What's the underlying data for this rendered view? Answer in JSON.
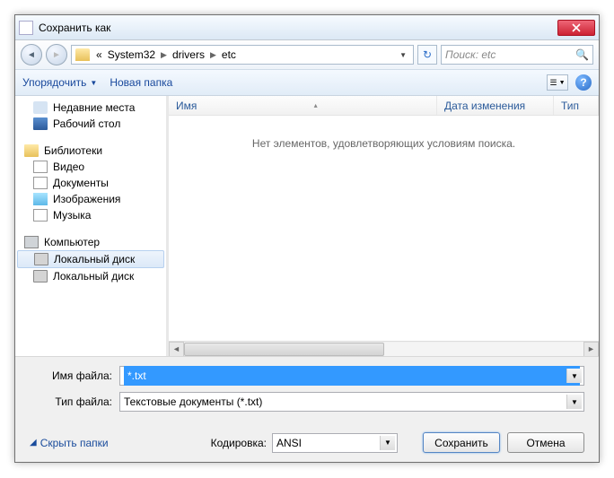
{
  "title": "Сохранить как",
  "breadcrumb": {
    "sep0": "«",
    "p1": "System32",
    "p2": "drivers",
    "p3": "etc"
  },
  "search": {
    "placeholder": "Поиск: etc"
  },
  "toolbar": {
    "organize": "Упорядочить",
    "newfolder": "Новая папка"
  },
  "tree": {
    "recent": "Недавние места",
    "desktop": "Рабочий стол",
    "libraries": "Библиотеки",
    "video": "Видео",
    "documents": "Документы",
    "images": "Изображения",
    "music": "Музыка",
    "computer": "Компьютер",
    "disk1": "Локальный диск",
    "disk2": "Локальный диск"
  },
  "columns": {
    "name": "Имя",
    "date": "Дата изменения",
    "type": "Тип"
  },
  "empty_msg": "Нет элементов, удовлетворяющих условиям поиска.",
  "filename_label": "Имя файла:",
  "filename_value": "*.txt",
  "filetype_label": "Тип файла:",
  "filetype_value": "Текстовые документы (*.txt)",
  "encoding_label": "Кодировка:",
  "encoding_value": "ANSI",
  "hide_folders": "Скрыть папки",
  "save_btn": "Сохранить",
  "cancel_btn": "Отмена"
}
